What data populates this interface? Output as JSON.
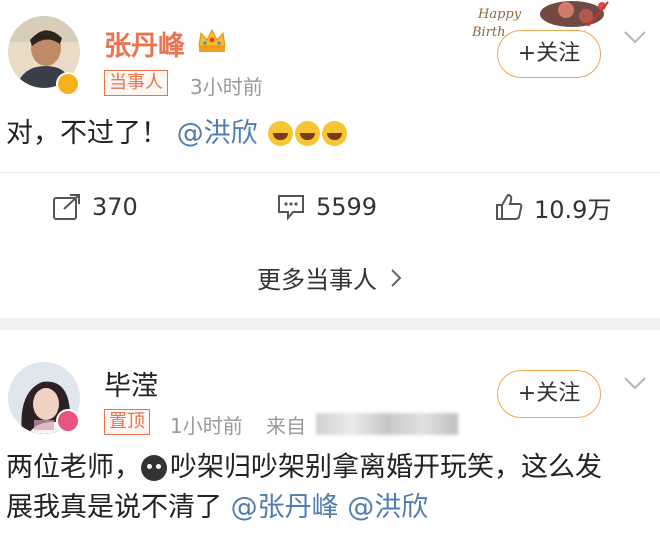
{
  "post1": {
    "username": "张丹峰",
    "tag": "当事人",
    "time": "3小时前",
    "follow_label": "+关注",
    "content_text": "对，不过了！",
    "mention": "@洪欣",
    "emoji_icons": [
      "laughing-tears-icon",
      "laughing-tears-icon",
      "laughing-tears-icon"
    ],
    "deco_text": "Happy Birth",
    "actions": {
      "repost_count": "370",
      "comment_count": "5599",
      "like_count": "10.9万"
    },
    "more_label": "更多当事人"
  },
  "post2": {
    "username": "毕滢",
    "tag": "置顶",
    "time": "1小时前",
    "source_label": "来自",
    "follow_label": "+关注",
    "content_line1_a": "两位老师，",
    "content_line1_b": "吵架归吵架别拿离婚开玩笑，这么发",
    "content_line2": "展我真是说不清了",
    "mention1": "@张丹峰",
    "mention2": "@洪欣"
  },
  "colors": {
    "accent_orange": "#eb7350",
    "mention_blue": "#507daf",
    "follow_border": "#f2a650",
    "verified_gold": "#f6b21a",
    "verified_pink": "#e8537f"
  }
}
